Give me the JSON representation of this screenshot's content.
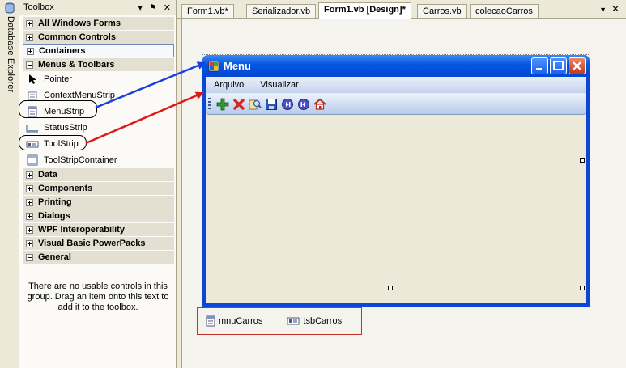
{
  "side_strip": {
    "label": "Database Explorer"
  },
  "toolbox": {
    "title": "Toolbox",
    "pin_label": "▾",
    "autohide_label": "⚑",
    "close_label": "✕",
    "categories_top": [
      {
        "label": "All Windows Forms",
        "state": "collapsed"
      },
      {
        "label": "Common Controls",
        "state": "collapsed"
      },
      {
        "label": "Containers",
        "state": "collapsed",
        "selected": true
      },
      {
        "label": "Menus & Toolbars",
        "state": "expanded"
      }
    ],
    "items": [
      {
        "label": "Pointer",
        "icon": "pointer-icon"
      },
      {
        "label": "ContextMenuStrip",
        "icon": "context-menu-icon"
      },
      {
        "label": "MenuStrip",
        "icon": "menustrip-icon",
        "circled": true
      },
      {
        "label": "StatusStrip",
        "icon": "statusstrip-icon"
      },
      {
        "label": "ToolStrip",
        "icon": "toolstrip-icon",
        "circled": true
      },
      {
        "label": "ToolStripContainer",
        "icon": "toolstrip-container-icon"
      }
    ],
    "categories_bottom": [
      {
        "label": "Data",
        "state": "collapsed"
      },
      {
        "label": "Components",
        "state": "collapsed"
      },
      {
        "label": "Printing",
        "state": "collapsed"
      },
      {
        "label": "Dialogs",
        "state": "collapsed"
      },
      {
        "label": "WPF Interoperability",
        "state": "collapsed"
      },
      {
        "label": "Visual Basic PowerPacks",
        "state": "collapsed"
      },
      {
        "label": "General",
        "state": "expanded"
      }
    ],
    "empty_message": "There are no usable controls in this group. Drag an item onto this text to add it to the toolbox."
  },
  "tabs": [
    {
      "label": "Form1.vb*",
      "active": false
    },
    {
      "label": "Serializador.vb",
      "active": false
    },
    {
      "label": "Form1.vb [Design]*",
      "active": true
    },
    {
      "label": "Carros.vb",
      "active": false
    },
    {
      "label": "colecaoCarros",
      "active": false
    }
  ],
  "tab_controls": {
    "menu_label": "▼",
    "close_label": "✕"
  },
  "form": {
    "title": "Menu",
    "menu_items": [
      "Arquivo",
      "Visualizar"
    ],
    "toolbar_buttons": [
      "add-icon",
      "delete-icon",
      "search-icon",
      "save-icon",
      "next-icon",
      "previous-icon",
      "home-icon"
    ]
  },
  "tray": {
    "items": [
      {
        "label": "mnuCarros",
        "icon": "menustrip-icon"
      },
      {
        "label": "tsbCarros",
        "icon": "toolstrip-icon"
      }
    ]
  },
  "annotation_colors": {
    "menustrip_arrow": "#1a3fe0",
    "toolstrip_arrow": "#e01818",
    "tray_border": "#c3312e"
  }
}
